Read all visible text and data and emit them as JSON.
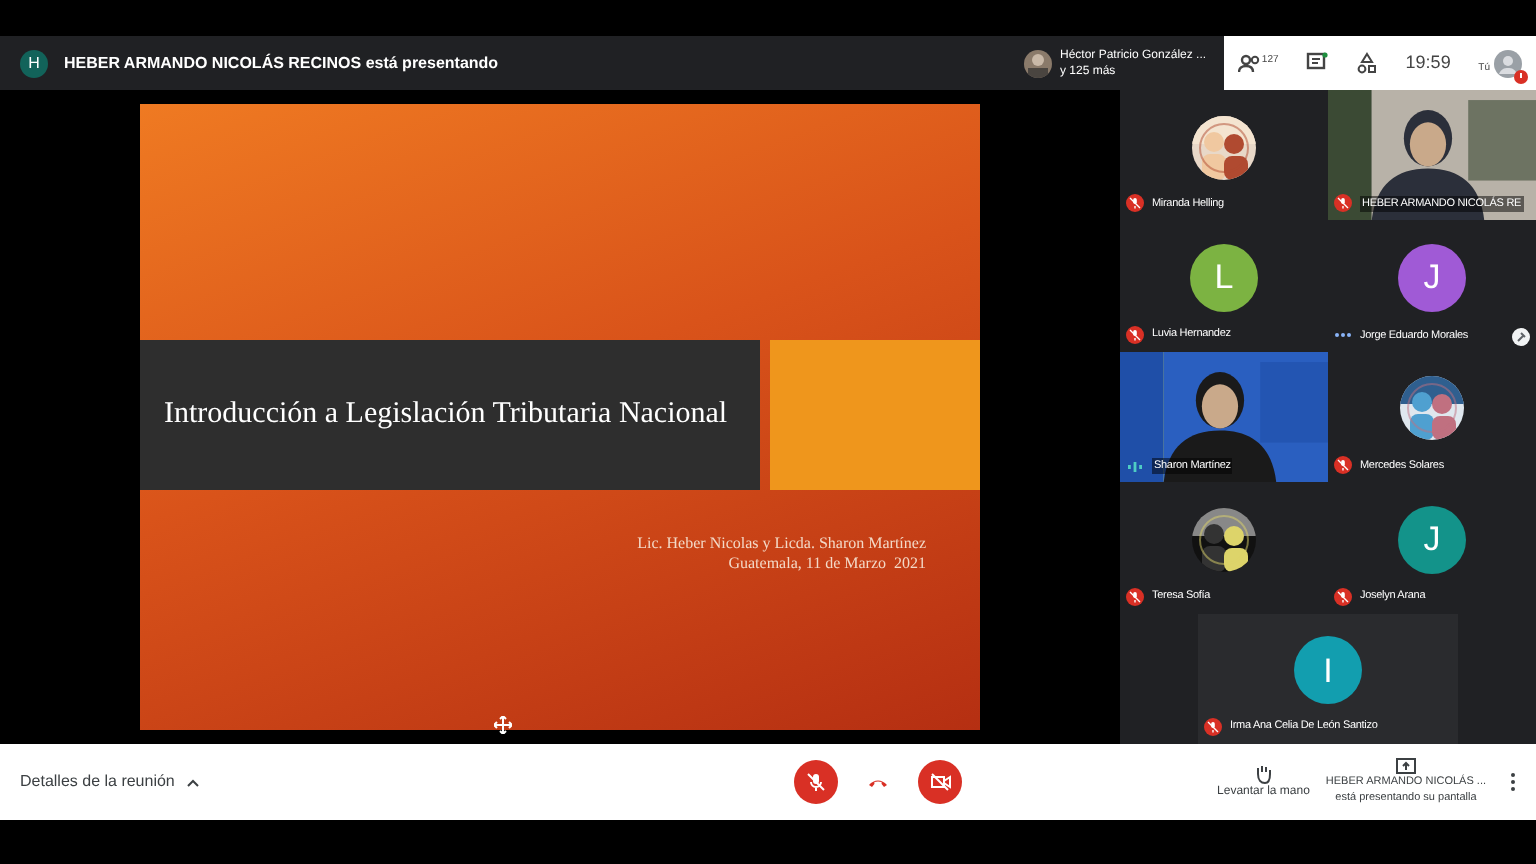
{
  "presenter_bar": {
    "avatar_letter": "H",
    "text": "HEBER ARMANDO NICOLÁS RECINOS está presentando"
  },
  "host": {
    "name": "Héctor Patricio González ...",
    "others": "y 125 más"
  },
  "top_controls": {
    "people_count": "127",
    "time": "19:59",
    "self_label": "Tú"
  },
  "slide": {
    "title": "Introducción a Legislación Tributaria Nacional",
    "authors": "Lic. Heber Nicolas y Licda. Sharon Martínez",
    "place_date": "Guatemala, 11 de Marzo  2021"
  },
  "participants": [
    {
      "name": "Miranda Helling",
      "muted": true
    },
    {
      "name": "HEBER ARMANDO NICOLÁS RE",
      "kind": "video",
      "muted": true
    },
    {
      "name": "Luvia Hernandez",
      "kind": "letter",
      "letter": "L",
      "color": "#7cb342",
      "muted": true
    },
    {
      "name": "Jorge Eduardo Morales",
      "kind": "letter",
      "letter": "J",
      "color": "#a05ad6",
      "muted": false,
      "speaking": false
    },
    {
      "name": "Sharon Martínez",
      "kind": "video",
      "muted": false,
      "speaking": true
    },
    {
      "name": "Mercedes Solares",
      "muted": true
    },
    {
      "name": "Teresa Sofía",
      "muted": true
    },
    {
      "name": "Joselyn Arana",
      "kind": "letter",
      "letter": "J",
      "color": "#13938a",
      "muted": true
    },
    {
      "name": "Irma Ana Celia De León Santizo",
      "kind": "letter",
      "letter": "I",
      "color": "#129eaf",
      "muted": true
    }
  ],
  "bottom_bar": {
    "details": "Detalles de la reunión",
    "raise_hand": "Levantar la mano",
    "presenting_name": "HEBER ARMANDO NICOLÁS ...",
    "presenting_note": "está presentando su pantalla"
  }
}
